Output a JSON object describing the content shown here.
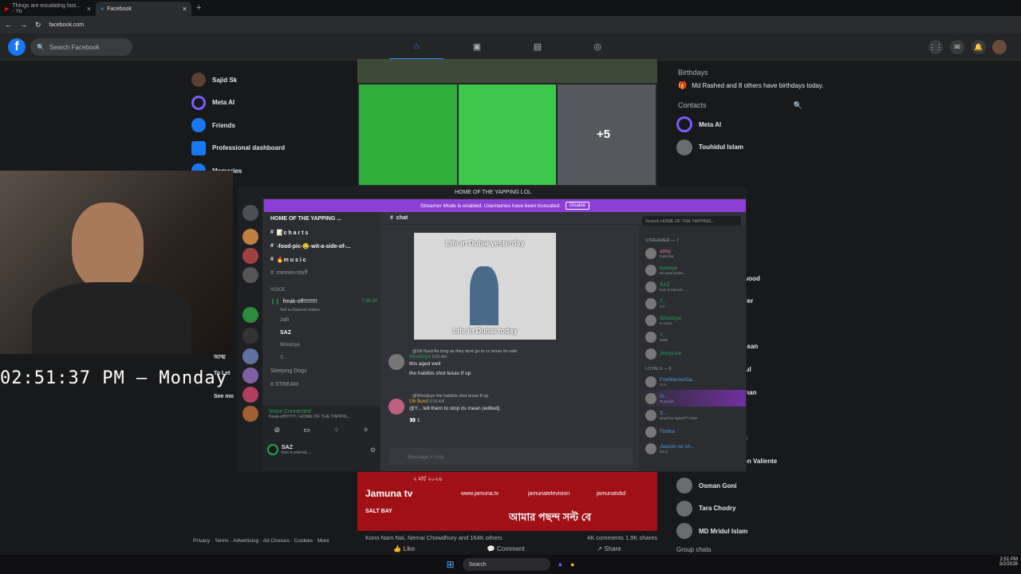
{
  "browser": {
    "tabs": [
      {
        "label": "Things are escalating fast... - Yo"
      },
      {
        "label": "Facebook"
      }
    ],
    "url": "facebook.com"
  },
  "fb": {
    "search_placeholder": "Search Facebook",
    "left_nav": [
      "Sajid Sk",
      "Meta AI",
      "Friends",
      "Professional dashboard",
      "Memories"
    ],
    "left_nav_partial": [
      "আত্ম",
      "To Let",
      "See mo"
    ],
    "photo_more": "+5",
    "birthdays_title": "Birthdays",
    "birthday_text": "Md Rashed and 8 others have birthdays today.",
    "contacts_title": "Contacts",
    "contacts": [
      "Meta AI",
      "Touhidul Islam",
      "Osman Goni",
      "Tara Chodry",
      "MD Mridul Islam"
    ],
    "contacts_partial": [
      "wood",
      "der",
      "asan",
      "tul",
      "man",
      "fi",
      "on Valiente"
    ],
    "group_chats": "Group chats",
    "footer": "Privacy · Terms · Advertising · Ad Choices · Cookies · More",
    "post_reactions": "Kono Nam Nai, Nemai Chowdhury and 164K others",
    "post_stats": "4K comments  1.9K shares",
    "actions": [
      "Like",
      "Comment",
      "Share"
    ],
    "ad_url": "www.jamuna.tv",
    "ad_fb": "jamunatelevision",
    "ad_handle": "jamunatvbd",
    "ad_bangla": "আমার পছন্দ সল্ট বে",
    "ad_brand": "Jamuna tv",
    "ad_salt": "SALT BAY",
    "ad_date": "২ মার্চ ২০২৬"
  },
  "stream": {
    "clock": "02:51:37 PM — Monday"
  },
  "discord": {
    "window_title": "HOME OF THE YAPPING LOL",
    "banner": "Streamer Mode is enabled. Usernames have been truncated.",
    "banner_btn": "Disable",
    "server": "HOME OF THE YAPPING ...",
    "channels": [
      "📝c h a r t s",
      "-food-pic-🤤-wit-a-side-of-...",
      "🔥m u s i c",
      "memes-stuff"
    ],
    "voice_header": "VOICE",
    "voice_channel": "freak-off!!!!!!!!!",
    "voice_time": "7:36:34",
    "voice_status": "Set a channel status",
    "voice_users": [
      "Jah",
      "SAZ",
      "Woodzye",
      "Y..."
    ],
    "other_channels": [
      "Sleeping Dogs",
      "# STREAM"
    ],
    "vc_connected": "Voice Connected",
    "vc_sub": "freak-off!!!!!!!!! / HOME OF THE YAPPIN...",
    "user": "SAZ",
    "user_status": "love is eternal.....",
    "chat_channel": "chat",
    "search": "Search HOME OF THE YAPPING...",
    "meme_top": "Life in Dubai yesterday",
    "meme_bottom": "Life in Dubai today",
    "messages": [
      {
        "reply": "@Ub fluxd As long as they dont go to cc texas im safe",
        "author": "Woodzye",
        "time": "9:01 AM",
        "lines": [
          "this aged well",
          "the habibis shot texas tf up"
        ]
      },
      {
        "reply": "@Woodzye the habibis shot texas tf up",
        "author": "Ub fluxd",
        "time": "9:05 AM",
        "lines": [
          "@Y... tell them to stop its mean (edited)"
        ]
      }
    ],
    "reaction": "1",
    "message_placeholder": "Message # chat",
    "streamer_header": "STREAMER — 7",
    "streamers": [
      {
        "name": "abby",
        "sub": "thats hot"
      },
      {
        "name": "bulzeye",
        "sub": "No save points."
      },
      {
        "name": "SAZ",
        "sub": "love is eternal......"
      },
      {
        "name": "T...",
        "sub": "LIT"
      },
      {
        "name": "Woodzye",
        "sub": "In voice"
      },
      {
        "name": "Y...",
        "sub": "SMD"
      },
      {
        "name": "JinnyLive",
        "sub": ""
      }
    ],
    "loyals_header": "LOYALS — 5",
    "loyals": [
      {
        "name": "FoxWarriorGa...",
        "sub": "G.A."
      },
      {
        "name": "O...",
        "sub": "RuneLite"
      },
      {
        "name": "S...",
        "sub": "Need for Speed™ Heat"
      },
      {
        "name": "Tishka",
        "sub": ""
      },
      {
        "name": "Jasmin ne ch...",
        "sub": "KILO"
      }
    ]
  },
  "taskbar": {
    "search": "Search",
    "time": "2:51 PM",
    "date": "3/2/2026"
  }
}
